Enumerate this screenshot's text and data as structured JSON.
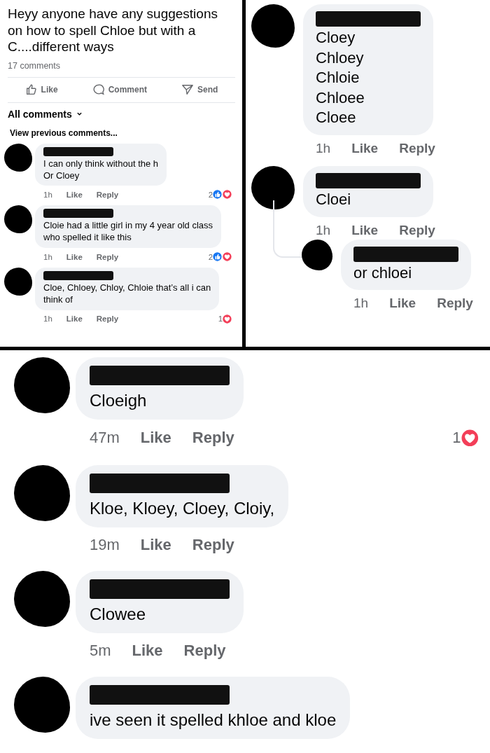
{
  "panels": [
    {
      "kind": "post",
      "post_text": "Heyy anyone have any suggestions\non how to spell Chloe but with a\nC....different ways",
      "comment_count": "17 comments",
      "actions": [
        {
          "kind": "like",
          "label": "Like"
        },
        {
          "kind": "comment",
          "label": "Comment"
        },
        {
          "kind": "send",
          "label": "Send"
        }
      ],
      "sort": "All comments",
      "view_previous": "View previous comments...",
      "comments": [
        {
          "text": "I can only think without the h\nOr Cloey",
          "time": "1h",
          "like": "Like",
          "reply": "Reply",
          "reaction_count": "2",
          "reactions": [
            {
              "kind": "like"
            },
            {
              "kind": "love"
            }
          ]
        },
        {
          "text": "Cloie had a little girl in my 4 year old class\nwho spelled it like this",
          "time": "1h",
          "like": "Like",
          "reply": "Reply",
          "reaction_count": "2",
          "reactions": [
            {
              "kind": "like"
            },
            {
              "kind": "love"
            }
          ]
        },
        {
          "text": "Cloe, Chloey, Chloy, Chloie that’s all i can\nthink of",
          "time": "1h",
          "like": "Like",
          "reply": "Reply",
          "reaction_count": "1",
          "reactions": [
            {
              "kind": "love"
            }
          ]
        }
      ]
    },
    {
      "kind": "thread",
      "comments": [
        {
          "text": "Cloey\nChloey\nChloie\nChloee\nCloee",
          "time": "1h",
          "like": "Like",
          "reply": "Reply"
        },
        {
          "text": "Cloei",
          "time": "1h",
          "like": "Like",
          "reply": "Reply",
          "children": [
            {
              "text": "or chloei",
              "time": "1h",
              "like": "Like",
              "reply": "Reply"
            }
          ]
        }
      ]
    },
    {
      "kind": "thread",
      "comments": [
        {
          "text": "Cloeigh",
          "time": "47m",
          "like": "Like",
          "reply": "Reply",
          "reaction_count": "1",
          "reactions": [
            {
              "kind": "love"
            }
          ]
        },
        {
          "text": "Kloe, Kloey, Cloey, Cloiy,",
          "time": "19m",
          "like": "Like",
          "reply": "Reply"
        },
        {
          "text": "Clowee",
          "time": "5m",
          "like": "Like",
          "reply": "Reply"
        },
        {
          "text": "ive seen it spelled khloe and kloe"
        }
      ]
    }
  ]
}
